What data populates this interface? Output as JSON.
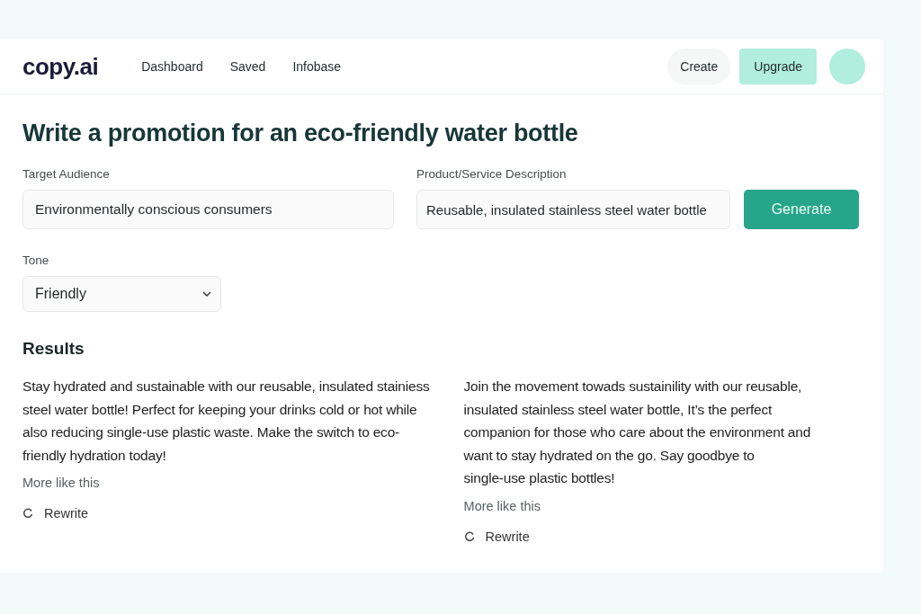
{
  "header": {
    "logo": "copy.ai",
    "nav": [
      {
        "label": "Dashboard"
      },
      {
        "label": "Saved"
      },
      {
        "label": "Infobase"
      }
    ],
    "create_button": "Create",
    "upgrade_button": "Upgrade"
  },
  "title": "Write a promotion for an eco-friendly water bottle",
  "form": {
    "audience": {
      "label": "Target Audience",
      "value": "Environmentally conscious consumers"
    },
    "description": {
      "label": "Product/Service Description",
      "value": "Reusable, insulated stainless steel water bottle"
    },
    "generate_button": "Generate",
    "tone": {
      "label": "Tone",
      "value": "Friendly"
    }
  },
  "results": {
    "heading": "Results",
    "items": [
      {
        "lines": [
          "Stay hydrated and sustainable with our reusable, insulated stainiess",
          "steel water bottle! Perfect for keeping your drinks cold or hot while",
          "also reducing single-use plastic waste. Make the switch to eco-",
          "friendly hydration today!"
        ],
        "more": "More like this",
        "rewrite": "Rewrite"
      },
      {
        "lines": [
          "Join the movement towads sustainility with our reusable,",
          "insulated stainless steel water bottle, It’s the perfect",
          "companion for those who care about the environment and",
          "want to stay hydrated on the go. Say goodbye to",
          "single-use plastic bottles!"
        ],
        "more": "More like this",
        "rewrite": "Rewrite"
      }
    ]
  }
}
